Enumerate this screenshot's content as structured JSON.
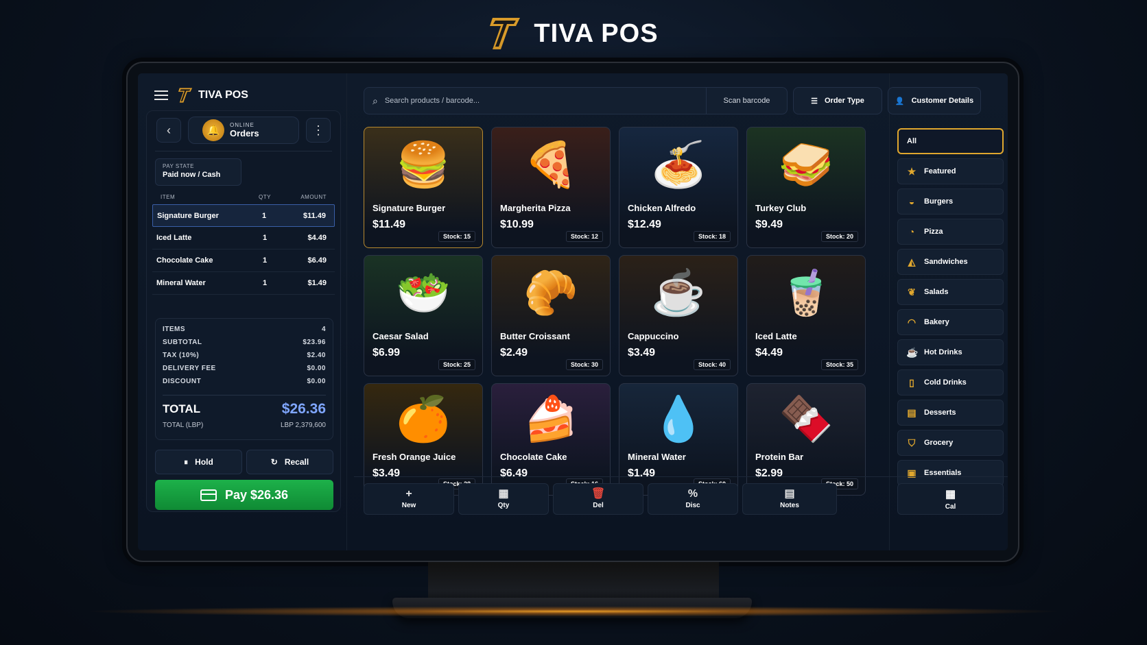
{
  "brand": {
    "name": "TIVA POS",
    "accent": "#e0a72e"
  },
  "sidebar_head": {
    "name": "TIVA POS"
  },
  "orders": {
    "sub": "ONLINE",
    "title": "Orders"
  },
  "pay_state": {
    "label": "PAY STATE",
    "value": "Paid now / Cash"
  },
  "cart_columns": {
    "item": "ITEM",
    "qty": "QTY",
    "amount": "AMOUNT"
  },
  "cart_items": [
    {
      "name": "Signature Burger",
      "qty": "1",
      "amount": "$11.49",
      "selected": true
    },
    {
      "name": "Iced Latte",
      "qty": "1",
      "amount": "$4.49"
    },
    {
      "name": "Chocolate Cake",
      "qty": "1",
      "amount": "$6.49"
    },
    {
      "name": "Mineral Water",
      "qty": "1",
      "amount": "$1.49"
    }
  ],
  "summary": {
    "items_label": "ITEMS",
    "items": "4",
    "subtotal_label": "SUBTOTAL",
    "subtotal": "$23.96",
    "tax_label": "TAX (10%)",
    "tax": "$2.40",
    "delivery_label": "DELIVERY FEE",
    "delivery": "$0.00",
    "discount_label": "DISCOUNT",
    "discount": "$0.00",
    "total_label": "TOTAL",
    "total": "$26.36",
    "total_lbp_label": "TOTAL (LBP)",
    "total_lbp": "LBP 2,379,600"
  },
  "buttons": {
    "hold": "Hold",
    "recall": "Recall",
    "pay": "Pay $26.36"
  },
  "search": {
    "placeholder": "Search products / barcode...",
    "scan": "Scan barcode",
    "order_type": "Order Type",
    "customer": "Customer Details"
  },
  "products": [
    {
      "name": "Signature Burger",
      "price": "$11.49",
      "stock": "Stock: 15",
      "icon": "burger-icon",
      "glyph": "🍔",
      "bg": "#3a2f1a"
    },
    {
      "name": "Margherita Pizza",
      "price": "$10.99",
      "stock": "Stock: 12",
      "icon": "pizza-icon",
      "glyph": "🍕",
      "bg": "#3a1f1a"
    },
    {
      "name": "Chicken Alfredo",
      "price": "$12.49",
      "stock": "Stock: 18",
      "icon": "pasta-icon",
      "glyph": "🍝",
      "bg": "#16273f"
    },
    {
      "name": "Turkey Club",
      "price": "$9.49",
      "stock": "Stock: 20",
      "icon": "sandwich-icon",
      "glyph": "🥪",
      "bg": "#1c3322"
    },
    {
      "name": "Caesar Salad",
      "price": "$6.99",
      "stock": "Stock: 25",
      "icon": "salad-icon",
      "glyph": "🥗",
      "bg": "#1a3324"
    },
    {
      "name": "Butter Croissant",
      "price": "$2.49",
      "stock": "Stock: 30",
      "icon": "croissant-icon",
      "glyph": "🥐",
      "bg": "#2f2417"
    },
    {
      "name": "Cappuccino",
      "price": "$3.49",
      "stock": "Stock: 40",
      "icon": "coffee-icon",
      "glyph": "☕",
      "bg": "#2b2118"
    },
    {
      "name": "Iced Latte",
      "price": "$4.49",
      "stock": "Stock: 35",
      "icon": "iced-latte-icon",
      "glyph": "🧋",
      "bg": "#211c1a"
    },
    {
      "name": "Fresh Orange Juice",
      "price": "$3.49",
      "stock": "Stock: 28",
      "icon": "juice-icon",
      "glyph": "🍊",
      "bg": "#35280f"
    },
    {
      "name": "Chocolate Cake",
      "price": "$6.49",
      "stock": "Stock: 16",
      "icon": "cake-icon",
      "glyph": "🍰",
      "bg": "#2a1f3c"
    },
    {
      "name": "Mineral Water",
      "price": "$1.49",
      "stock": "Stock: 60",
      "icon": "water-bottle-icon",
      "glyph": "💧",
      "bg": "#17263a"
    },
    {
      "name": "Protein Bar",
      "price": "$2.99",
      "stock": "Stock: 50",
      "icon": "protein-bar-icon",
      "glyph": "🍫",
      "bg": "#1e2330"
    }
  ],
  "categories": [
    {
      "label": "All",
      "icon": "",
      "active": true
    },
    {
      "label": "Featured",
      "icon": "★"
    },
    {
      "label": "Burgers",
      "icon": "◒"
    },
    {
      "label": "Pizza",
      "icon": "◔"
    },
    {
      "label": "Sandwiches",
      "icon": "◭"
    },
    {
      "label": "Salads",
      "icon": "❦"
    },
    {
      "label": "Bakery",
      "icon": "◠"
    },
    {
      "label": "Hot Drinks",
      "icon": "☕"
    },
    {
      "label": "Cold Drinks",
      "icon": "▯"
    },
    {
      "label": "Desserts",
      "icon": "▤"
    },
    {
      "label": "Grocery",
      "icon": "⛉"
    },
    {
      "label": "Essentials",
      "icon": "▣"
    }
  ],
  "actions": [
    {
      "label": "New",
      "icon": "+",
      "name": "new"
    },
    {
      "label": "Qty",
      "icon": "▦",
      "name": "qty"
    },
    {
      "label": "Del",
      "icon": "🗑",
      "name": "del"
    },
    {
      "label": "Disc",
      "icon": "%",
      "name": "disc"
    },
    {
      "label": "Notes",
      "icon": "▤",
      "name": "notes"
    }
  ],
  "calc": {
    "label": "Cal",
    "icon": "▦"
  }
}
